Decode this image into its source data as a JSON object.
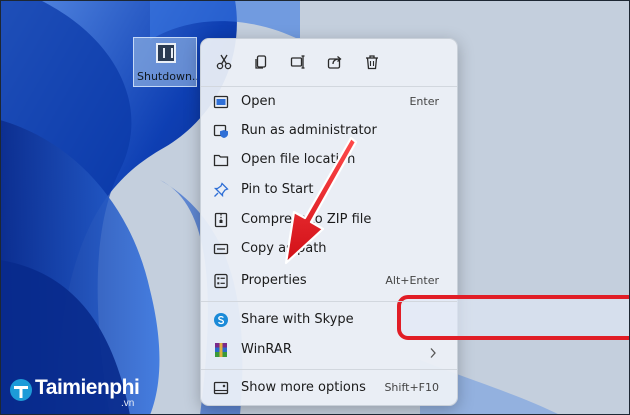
{
  "desktop": {
    "icon_caption": "Shutdown..."
  },
  "context_menu": {
    "toolbar": [
      {
        "name": "cut-icon"
      },
      {
        "name": "copy-icon"
      },
      {
        "name": "rename-icon"
      },
      {
        "name": "share-icon"
      },
      {
        "name": "delete-icon"
      }
    ],
    "items": [
      {
        "label": "Open",
        "shortcut": "Enter",
        "icon": "open-icon"
      },
      {
        "label": "Run as administrator",
        "shortcut": "",
        "icon": "shield-icon"
      },
      {
        "label": "Open file location",
        "shortcut": "",
        "icon": "folder-icon"
      },
      {
        "label": "Pin to Start",
        "shortcut": "",
        "icon": "pin-icon"
      },
      {
        "label": "Compress to ZIP file",
        "shortcut": "",
        "icon": "zip-icon"
      },
      {
        "label": "Copy as path",
        "shortcut": "",
        "icon": "copy-path-icon"
      },
      {
        "label": "Properties",
        "shortcut": "Alt+Enter",
        "icon": "properties-icon"
      },
      {
        "label": "Share with Skype",
        "shortcut": "",
        "icon": "skype-icon"
      },
      {
        "label": "WinRAR",
        "shortcut": "",
        "icon": "winrar-icon"
      },
      {
        "label": "Show more options",
        "shortcut": "Shift+F10",
        "icon": "more-options-icon"
      }
    ]
  },
  "watermark": {
    "brand": "Taimienphi",
    "domain": ".vn"
  },
  "colors": {
    "wallpaper_blue": "#0b3fb4",
    "highlight_red": "#e11d26",
    "menu_bg": "#ecf0f6"
  }
}
